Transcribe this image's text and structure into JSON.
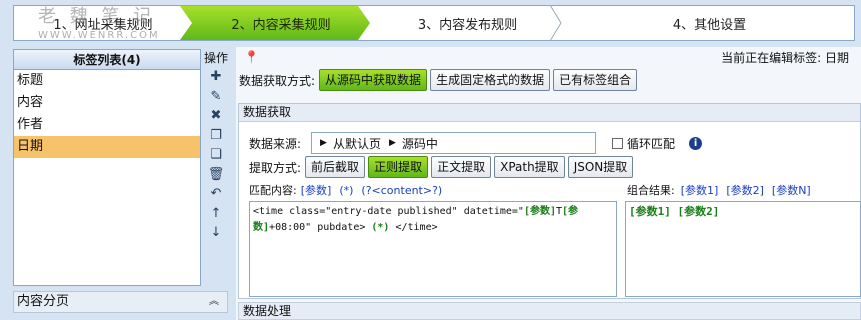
{
  "watermark": {
    "title": "老 魏 笔 记",
    "url": "WWW.WENRR.COM"
  },
  "steps": [
    {
      "label": "1、网址采集规则"
    },
    {
      "label": "2、内容采集规则"
    },
    {
      "label": "3、内容发布规则"
    },
    {
      "label": "4、其他设置"
    }
  ],
  "tag_list": {
    "title": "标签列表(4)",
    "items": [
      {
        "label": "标题"
      },
      {
        "label": "内容"
      },
      {
        "label": "作者"
      },
      {
        "label": "日期"
      }
    ]
  },
  "ops": {
    "title": "操作"
  },
  "pagination": {
    "label": "内容分页"
  },
  "editing": {
    "text": "当前正在编辑标签: 日期"
  },
  "fetch_mode": {
    "label": "数据获取方式:",
    "options": [
      {
        "label": "从源码中获取数据"
      },
      {
        "label": "生成固定格式的数据"
      },
      {
        "label": "已有标签组合"
      }
    ]
  },
  "data_fetch": {
    "title": "数据获取",
    "source_label": "数据来源:",
    "source_path": [
      "从默认页",
      "源码中"
    ],
    "loop_match": "循环匹配",
    "extract_label": "提取方式:",
    "extract_options": [
      {
        "label": "前后截取"
      },
      {
        "label": "正则提取"
      },
      {
        "label": "正文提取"
      },
      {
        "label": "XPath提取"
      },
      {
        "label": "JSON提取"
      }
    ],
    "match_label": "匹配内容:",
    "match_tokens": [
      "[参数]",
      "(*)",
      "(?<content>?)"
    ],
    "result_label": "组合结果:",
    "result_tokens": [
      "[参数1]",
      "[参数2]",
      "[参数N]"
    ],
    "pattern": {
      "p1": "<time class=\"entry-date published\" datetime=\"",
      "p2": "[参数]",
      "p3": "T",
      "p4": "[参数]",
      "p5": "+",
      "p6": "08:00\" pubdate> ",
      "p7": "(*)",
      "p8": " </time>"
    },
    "result_value": "[参数1] [参数2]"
  },
  "data_processing": {
    "title": "数据处理"
  }
}
